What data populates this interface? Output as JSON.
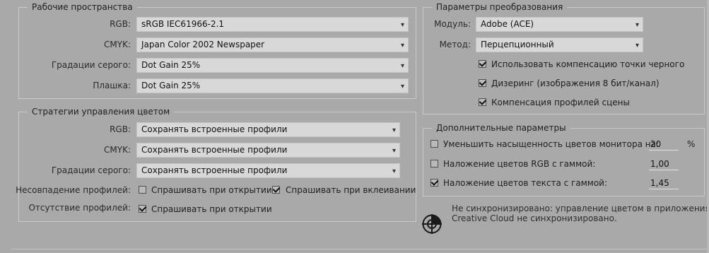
{
  "working_spaces": {
    "title": "Рабочие пространства",
    "rgb": {
      "label": "RGB:",
      "value": "sRGB IEC61966-2.1"
    },
    "cmyk": {
      "label": "CMYK:",
      "value": "Japan Color 2002 Newspaper"
    },
    "gray": {
      "label": "Градации серого:",
      "value": "Dot Gain 25%"
    },
    "spot": {
      "label": "Плашка:",
      "value": "Dot Gain 25%"
    }
  },
  "policies": {
    "title": "Стратегии управления цветом",
    "rgb": {
      "label": "RGB:",
      "value": "Сохранять встроенные профили"
    },
    "cmyk": {
      "label": "CMYK:",
      "value": "Сохранять встроенные профили"
    },
    "gray": {
      "label": "Градации серого:",
      "value": "Сохранять встроенные профили"
    },
    "mismatch": {
      "label": "Несовпадение профилей:",
      "ask_open": {
        "label": "Спрашивать при открытии",
        "checked": false
      },
      "ask_paste": {
        "label": "Спрашивать при вклеивании",
        "checked": true
      }
    },
    "missing": {
      "label": "Отсутствие профилей:",
      "ask_open": {
        "label": "Спрашивать при открытии",
        "checked": true
      }
    }
  },
  "conversion": {
    "title": "Параметры преобразования",
    "engine": {
      "label": "Модуль:",
      "value": "Adobe (ACE)"
    },
    "intent": {
      "label": "Метод:",
      "value": "Перцепционный"
    },
    "black_point": {
      "label": "Использовать компенсацию точки черного",
      "checked": true
    },
    "dither": {
      "label": "Дизеринг (изображения 8 бит/канал)",
      "checked": true
    },
    "scene": {
      "label": "Компенсация профилей сцены",
      "checked": true
    }
  },
  "advanced": {
    "title": "Дополнительные параметры",
    "desaturate": {
      "label": "Уменьшить насыщенность цветов монитора на:",
      "checked": false,
      "value": "20",
      "unit": "%"
    },
    "blend_rgb": {
      "label": "Наложение цветов RGB с гаммой:",
      "checked": false,
      "value": "1,00"
    },
    "blend_text": {
      "label": "Наложение цветов текста с гаммой:",
      "checked": true,
      "value": "1,45"
    }
  },
  "sync": {
    "icon": "sync-status-icon",
    "text_line1": "Не синхронизировано: управление цветом в приложениях",
    "text_line2": "Creative Cloud не синхронизировано."
  }
}
